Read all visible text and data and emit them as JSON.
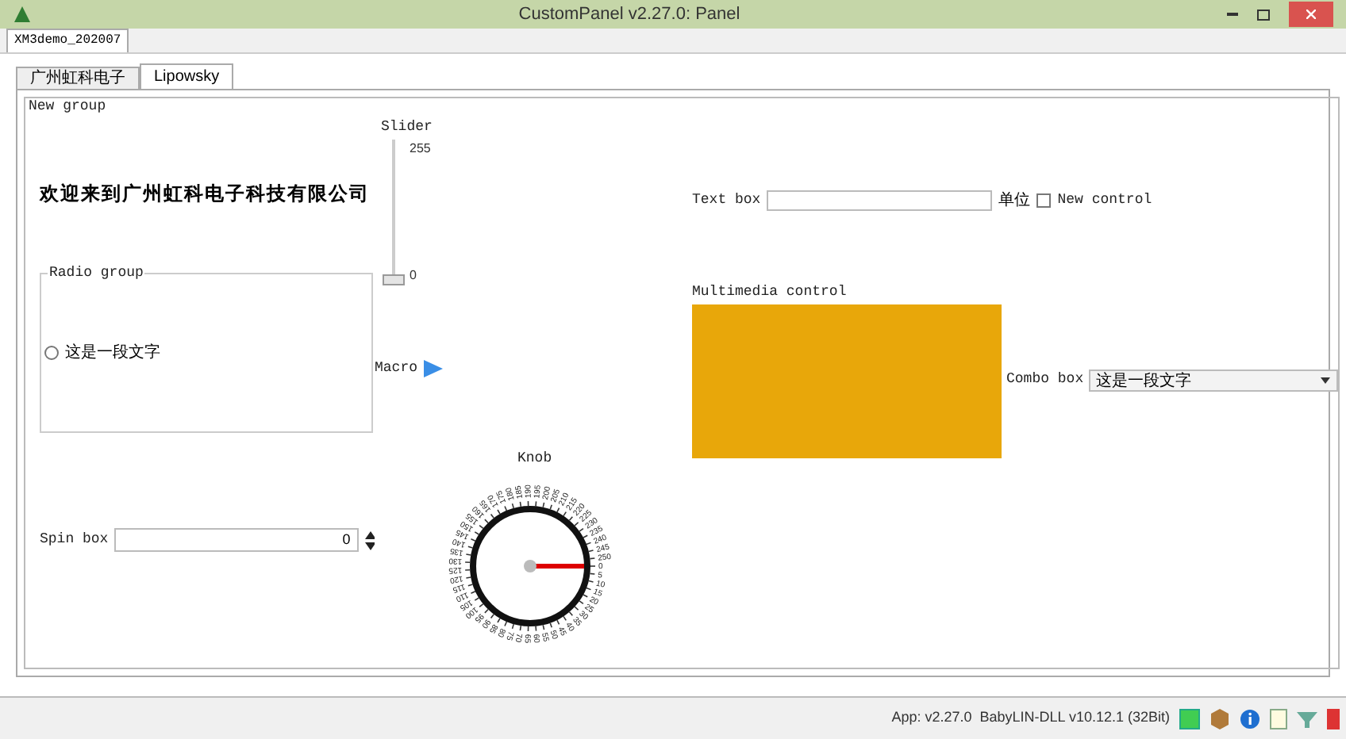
{
  "window": {
    "title": "CustomPanel v2.27.0: Panel"
  },
  "document_tabs": [
    {
      "label": "XM3demo_202007",
      "selected": true
    }
  ],
  "tabs": [
    {
      "label": "广州虹科电子",
      "selected": false
    },
    {
      "label": "Lipowsky",
      "selected": true
    }
  ],
  "group": {
    "title": "New group"
  },
  "welcome_text": "欢迎来到广州虹科电子科技有限公司",
  "slider": {
    "label": "Slider",
    "max_label": "255",
    "min_label": "0",
    "level": 0
  },
  "text_box": {
    "label": "Text box",
    "unit": "单位"
  },
  "checkbox": {
    "label": "New control",
    "checked": false
  },
  "radio_group": {
    "title": "Radio group",
    "options": [
      {
        "label": "这是一段文字",
        "selected": false
      }
    ]
  },
  "macro": {
    "label": "Macro"
  },
  "multimedia": {
    "label": "Multimedia control",
    "color": "#e8a70a"
  },
  "combo_box": {
    "label": "Combo box",
    "value": "这是一段文字"
  },
  "spin_box": {
    "label": "Spin box",
    "value": "0"
  },
  "knob": {
    "label": "Knob",
    "scale_labels": [
      "0",
      "5",
      "10",
      "15",
      "20",
      "25",
      "30",
      "35",
      "40",
      "45",
      "50",
      "55",
      "60",
      "65",
      "70",
      "75",
      "80",
      "85",
      "90",
      "95",
      "100",
      "105",
      "110",
      "115",
      "120",
      "125",
      "130",
      "135",
      "140",
      "145",
      "150",
      "155",
      "160",
      "165",
      "170",
      "175",
      "180",
      "185",
      "190",
      "195",
      "200",
      "205",
      "210",
      "215",
      "220",
      "225",
      "230",
      "235",
      "240",
      "245",
      "250"
    ]
  },
  "status_bar": {
    "text": "App: v2.27.0  BabyLIN-DLL v10.12.1 (32Bit)"
  }
}
